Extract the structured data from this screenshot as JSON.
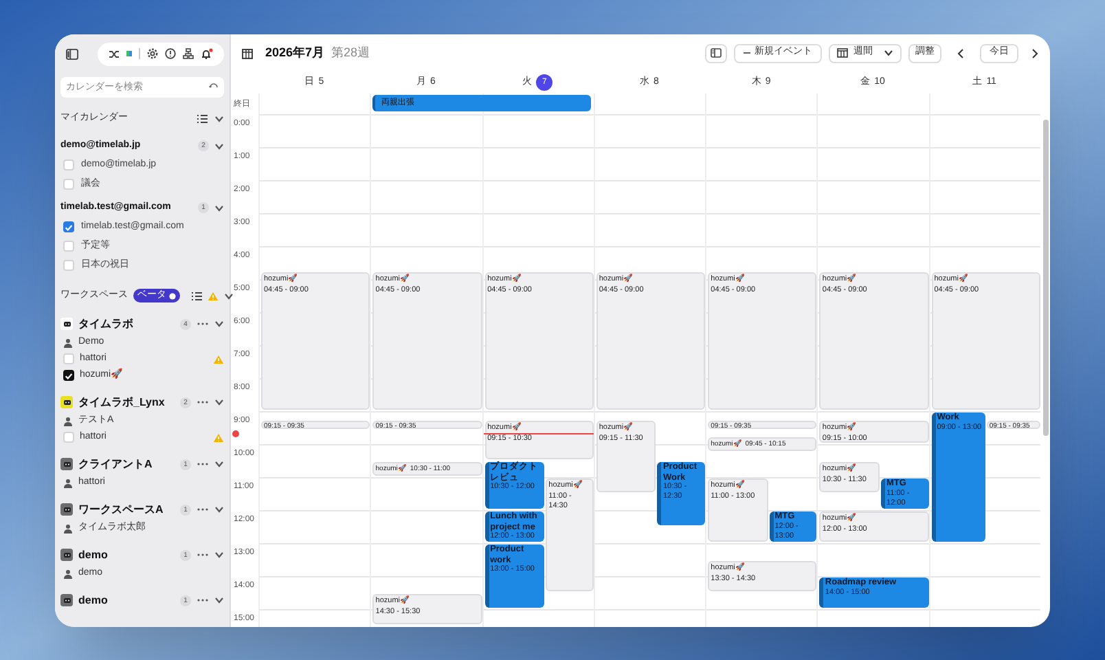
{
  "sidebar": {
    "search": {
      "placeholder": "カレンダーを検索"
    },
    "my_calendars": {
      "title": "マイカレンダー",
      "accounts": [
        {
          "name": "demo@timelab.jp",
          "count": "2",
          "calendars": [
            {
              "label": "demo@timelab.jp",
              "checked": false
            },
            {
              "label": "議会",
              "checked": false
            }
          ]
        },
        {
          "name": "timelab.test@gmail.com",
          "count": "1",
          "calendars": [
            {
              "label": "timelab.test@gmail.com",
              "checked": true
            },
            {
              "label": "予定等",
              "checked": false
            },
            {
              "label": "日本の祝日",
              "checked": false
            }
          ]
        }
      ]
    },
    "workspaces": {
      "title": "ワークスペース",
      "badge": "ベータ",
      "groups": [
        {
          "name": "タイムラボ",
          "count": "4",
          "color": "#ffffff",
          "members": [
            {
              "kind": "person",
              "label": "Demo"
            },
            {
              "kind": "checkbox",
              "label": "hattori",
              "checked": false,
              "warning": true
            },
            {
              "kind": "checkbox",
              "label": "hozumi🚀",
              "checked": true,
              "warning": false
            }
          ]
        },
        {
          "name": "タイムラボ_Lynx",
          "count": "2",
          "color": "#e8e020",
          "members": [
            {
              "kind": "person",
              "label": "テストA"
            },
            {
              "kind": "checkbox",
              "label": "hattori",
              "checked": false,
              "warning": true
            }
          ]
        },
        {
          "name": "クライアントA",
          "count": "1",
          "color": "#6b6b70",
          "members": [
            {
              "kind": "person",
              "label": "hattori"
            }
          ]
        },
        {
          "name": "ワークスペースA",
          "count": "1",
          "color": "#6b6b70",
          "members": [
            {
              "kind": "person",
              "label": "タイムラボ太郎"
            }
          ]
        },
        {
          "name": "demo",
          "count": "1",
          "color": "#6b6b70",
          "members": [
            {
              "kind": "person",
              "label": "demo"
            }
          ]
        },
        {
          "name": "demo",
          "count": "1",
          "color": "#6b6b70"
        }
      ]
    }
  },
  "header": {
    "month": "2026年7月",
    "week": "第28週",
    "new_event": "新規イベント",
    "view": "週間",
    "adjust": "調整",
    "today": "今日"
  },
  "all_day_label": "終日",
  "hours": [
    "0:00",
    "1:00",
    "2:00",
    "3:00",
    "4:00",
    "5:00",
    "6:00",
    "7:00",
    "8:00",
    "9:00",
    "10:00",
    "11:00",
    "12:00",
    "13:00",
    "14:00",
    "15:00"
  ],
  "days": [
    {
      "weekday": "日",
      "date": "5",
      "selected": false,
      "events": [
        {
          "kind": "busy",
          "title": "hozumi🚀",
          "time": "04:45 - 09:00"
        },
        {
          "kind": "busy",
          "time": "09:15 - 09:35"
        }
      ]
    },
    {
      "weekday": "月",
      "date": "6",
      "selected": false,
      "all_day": [
        {
          "title": "両親出張",
          "continues": true
        }
      ],
      "events": [
        {
          "kind": "busy",
          "title": "hozumi🚀",
          "time": "04:45 - 09:00"
        },
        {
          "kind": "busy",
          "time": "09:15 - 09:35"
        },
        {
          "kind": "busy",
          "title": "hozumi🚀",
          "time": "10:30 - 11:00"
        },
        {
          "kind": "busy",
          "title": "hozumi🚀",
          "time": "14:30 - 15:30"
        }
      ]
    },
    {
      "weekday": "火",
      "date": "7",
      "selected": true,
      "now_line": {
        "level": 0.402778
      },
      "events": [
        {
          "kind": "busy",
          "title": "hozumi🚀",
          "time": "04:45 - 09:00"
        },
        {
          "kind": "busy",
          "title": "hozumi🚀",
          "time": "09:15 - 10:30"
        },
        {
          "kind": "meeting",
          "title": "プロダクトレビュ",
          "time": "10:30 - 12:00"
        },
        {
          "kind": "busy",
          "title": "hozumi🚀",
          "time": "11:00 - 14:30"
        },
        {
          "kind": "meeting",
          "title": "Lunch with project me",
          "time": "12:00 - 13:00"
        },
        {
          "kind": "meeting",
          "title": "Product work",
          "time": "13:00 - 15:00"
        }
      ]
    },
    {
      "weekday": "水",
      "date": "8",
      "selected": false,
      "events": [
        {
          "kind": "busy",
          "title": "hozumi🚀",
          "time": "04:45 - 09:00"
        },
        {
          "kind": "busy",
          "title": "hozumi🚀",
          "time": "09:15 - 11:30"
        },
        {
          "kind": "meeting",
          "title": "Product Work",
          "time": "10:30 - 12:30"
        }
      ]
    },
    {
      "weekday": "木",
      "date": "9",
      "selected": false,
      "events": [
        {
          "kind": "busy",
          "title": "hozumi🚀",
          "time": "04:45 - 09:00"
        },
        {
          "kind": "busy",
          "time": "09:15 - 09:35"
        },
        {
          "kind": "busy",
          "title": "hozumi🚀",
          "time": "09:45 - 10:15"
        },
        {
          "kind": "busy",
          "title": "hozumi🚀",
          "time": "11:00 - 13:00"
        },
        {
          "kind": "meeting",
          "title": "MTG",
          "time": "12:00 - 13:00"
        },
        {
          "kind": "busy",
          "title": "hozumi🚀",
          "time": "13:30 - 14:30"
        }
      ]
    },
    {
      "weekday": "金",
      "date": "10",
      "selected": false,
      "events": [
        {
          "kind": "busy",
          "title": "hozumi🚀",
          "time": "04:45 - 09:00"
        },
        {
          "kind": "busy",
          "title": "hozumi🚀",
          "time": "09:15 - 10:00"
        },
        {
          "kind": "busy",
          "title": "hozumi🚀",
          "time": "10:30 - 11:30"
        },
        {
          "kind": "meeting",
          "title": "MTG",
          "time": "11:00 - 12:00"
        },
        {
          "kind": "busy",
          "title": "hozumi🚀",
          "time": "12:00 - 13:00"
        },
        {
          "kind": "meeting",
          "title": "Roadmap review",
          "time": "14:00 - 15:00"
        }
      ]
    },
    {
      "weekday": "土",
      "date": "11",
      "selected": false,
      "events": [
        {
          "kind": "busy",
          "title": "hozumi🚀",
          "time": "04:45 - 09:00"
        },
        {
          "kind": "meeting",
          "title": "Work",
          "time": "09:00 - 13:00"
        },
        {
          "kind": "busy",
          "time": "09:15 - 09:35"
        }
      ]
    }
  ]
}
